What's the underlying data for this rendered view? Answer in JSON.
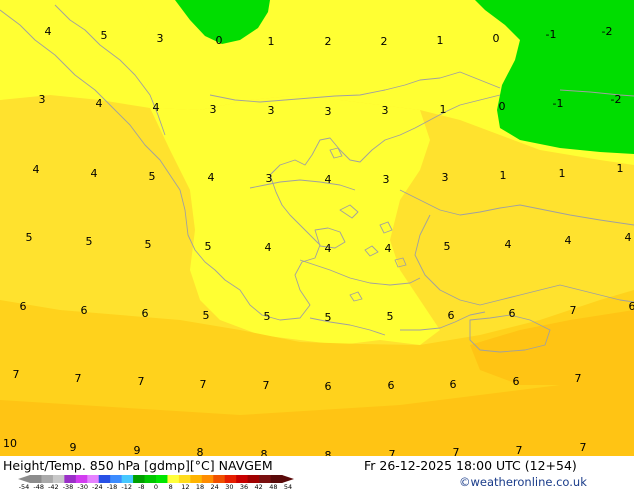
{
  "map": {
    "title_left": "Height/Temp. 850 hPa [gdmp][°C] NAVGEM",
    "title_right": "Fr 26-12-2025 18:00 UTC (12+54)",
    "credit": "©weatheronline.co.uk",
    "colors": {
      "band_cool": "#ffff33",
      "band_mid": "#ffe22e",
      "band_warm": "#ffd21c",
      "band_warmer": "#ffc414",
      "band_zero": "#00dd00",
      "coastline": "#a0a0a0"
    },
    "labels": [
      {
        "text": "4"
      },
      {
        "text": "5"
      },
      {
        "text": "3"
      },
      {
        "text": "0"
      },
      {
        "text": "1"
      },
      {
        "text": "2"
      },
      {
        "text": "2"
      },
      {
        "text": "1"
      },
      {
        "text": "0"
      },
      {
        "text": "-1"
      },
      {
        "text": "-2"
      },
      {
        "text": "3"
      },
      {
        "text": "4"
      },
      {
        "text": "4"
      },
      {
        "text": "3"
      },
      {
        "text": "3"
      },
      {
        "text": "3"
      },
      {
        "text": "3"
      },
      {
        "text": "1"
      },
      {
        "text": "0"
      },
      {
        "text": "-1"
      },
      {
        "text": "-2"
      },
      {
        "text": "4"
      },
      {
        "text": "4"
      },
      {
        "text": "5"
      },
      {
        "text": "4"
      },
      {
        "text": "3"
      },
      {
        "text": "4"
      },
      {
        "text": "3"
      },
      {
        "text": "3"
      },
      {
        "text": "1"
      },
      {
        "text": "1"
      },
      {
        "text": "1"
      },
      {
        "text": "5"
      },
      {
        "text": "5"
      },
      {
        "text": "5"
      },
      {
        "text": "5"
      },
      {
        "text": "4"
      },
      {
        "text": "4"
      },
      {
        "text": "4"
      },
      {
        "text": "5"
      },
      {
        "text": "4"
      },
      {
        "text": "4"
      },
      {
        "text": "4"
      },
      {
        "text": "6"
      },
      {
        "text": "6"
      },
      {
        "text": "6"
      },
      {
        "text": "5"
      },
      {
        "text": "5"
      },
      {
        "text": "5"
      },
      {
        "text": "5"
      },
      {
        "text": "6"
      },
      {
        "text": "6"
      },
      {
        "text": "7"
      },
      {
        "text": "6"
      },
      {
        "text": "7"
      },
      {
        "text": "7"
      },
      {
        "text": "7"
      },
      {
        "text": "7"
      },
      {
        "text": "7"
      },
      {
        "text": "6"
      },
      {
        "text": "6"
      },
      {
        "text": "6"
      },
      {
        "text": "6"
      },
      {
        "text": "7"
      },
      {
        "text": "10"
      },
      {
        "text": "9"
      },
      {
        "text": "9"
      },
      {
        "text": "8"
      },
      {
        "text": "8"
      },
      {
        "text": "8"
      },
      {
        "text": "7"
      },
      {
        "text": "7"
      },
      {
        "text": "7"
      },
      {
        "text": "7"
      }
    ]
  },
  "legend": {
    "ticks": [
      "-54",
      "-48",
      "-42",
      "-38",
      "-30",
      "-24",
      "-18",
      "-12",
      "-8",
      "0",
      "8",
      "12",
      "18",
      "24",
      "30",
      "36",
      "42",
      "48",
      "54"
    ],
    "colors": [
      "#8c8c8c",
      "#aaaaaa",
      "#c8c8c8",
      "#9b30c8",
      "#d23cf0",
      "#e682ff",
      "#2850e6",
      "#3c8cff",
      "#46c8ff",
      "#00a000",
      "#00c800",
      "#00e600",
      "#ffff3c",
      "#ffdc1e",
      "#ffb400",
      "#ff8c00",
      "#f05000",
      "#e61e00",
      "#c80000",
      "#a00000",
      "#7a1010",
      "#5a0a0a"
    ]
  }
}
